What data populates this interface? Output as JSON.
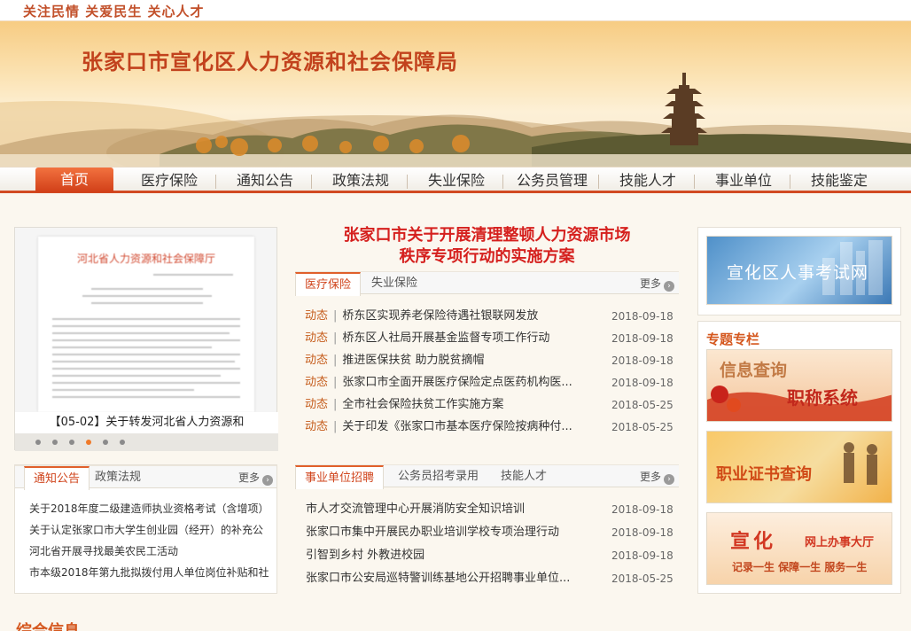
{
  "header": {
    "slogan": "关注民情  关爱民生  关心人才",
    "site_title": "张家口市宣化区人力资源和社会保障局"
  },
  "nav": {
    "items": [
      {
        "label": "首页",
        "active": true
      },
      {
        "label": "医疗保险"
      },
      {
        "label": "通知公告"
      },
      {
        "label": "政策法规"
      },
      {
        "label": "失业保险"
      },
      {
        "label": "公务员管理"
      },
      {
        "label": "技能人才"
      },
      {
        "label": "事业单位"
      },
      {
        "label": "技能鉴定"
      }
    ]
  },
  "slideshow": {
    "doc_title": "河北省人力资源和社会保障厅",
    "caption": "【05-02】关于转发河北省人力资源和",
    "dots": 6,
    "active_dot": 4
  },
  "headline": {
    "line1": "张家口市关于开展清理整顿人力资源市场",
    "line2": "秩序专项行动的实施方案"
  },
  "news1": {
    "tabs": [
      "医疗保险",
      "失业保险"
    ],
    "more": "更多",
    "tag": "动态",
    "items": [
      {
        "title": "桥东区实现养老保险待遇社银联网发放",
        "date": "2018-09-18"
      },
      {
        "title": "桥东区人社局开展基金监督专项工作行动",
        "date": "2018-09-18"
      },
      {
        "title": "推进医保扶贫 助力脱贫摘帽",
        "date": "2018-09-18"
      },
      {
        "title": "张家口市全面开展医疗保险定点医药机构医...",
        "date": "2018-09-18"
      },
      {
        "title": "全市社会保险扶贫工作实施方案",
        "date": "2018-05-25"
      },
      {
        "title": "关于印发《张家口市基本医疗保险按病种付...",
        "date": "2018-05-25"
      }
    ]
  },
  "notice": {
    "tabs": [
      "通知公告",
      "政策法规"
    ],
    "more": "更多",
    "items": [
      "关于2018年度二级建造师执业资格考试（含增项）",
      "关于认定张家口市大学生创业园（经开）的补充公",
      "河北省开展寻找最美农民工活动",
      "市本级2018年第九批拟拨付用人单位岗位补贴和社"
    ]
  },
  "news2": {
    "tabs": [
      "事业单位招聘",
      "公务员招考录用",
      "技能人才"
    ],
    "more": "更多",
    "items": [
      {
        "title": "市人才交流管理中心开展消防安全知识培训",
        "date": "2018-09-18"
      },
      {
        "title": "张家口市集中开展民办职业培训学校专项治理行动",
        "date": "2018-09-18"
      },
      {
        "title": "引智到乡村 外教进校园",
        "date": "2018-09-18"
      },
      {
        "title": "张家口市公安局巡特警训练基地公开招聘事业单位...",
        "date": "2018-05-25"
      }
    ]
  },
  "sidebar": {
    "exam_banner": "宣化区人事考试网",
    "section_title": "专题专栏",
    "cards": [
      {
        "line1": "信息查询",
        "line2": "职称系统"
      },
      {
        "text": "职业证书查询"
      },
      {
        "title": "宣化",
        "subtitle": "网上办事大厅",
        "slogan": "记录一生 保障一生 服务一生"
      }
    ]
  },
  "footer": {
    "title": "综合信息"
  }
}
